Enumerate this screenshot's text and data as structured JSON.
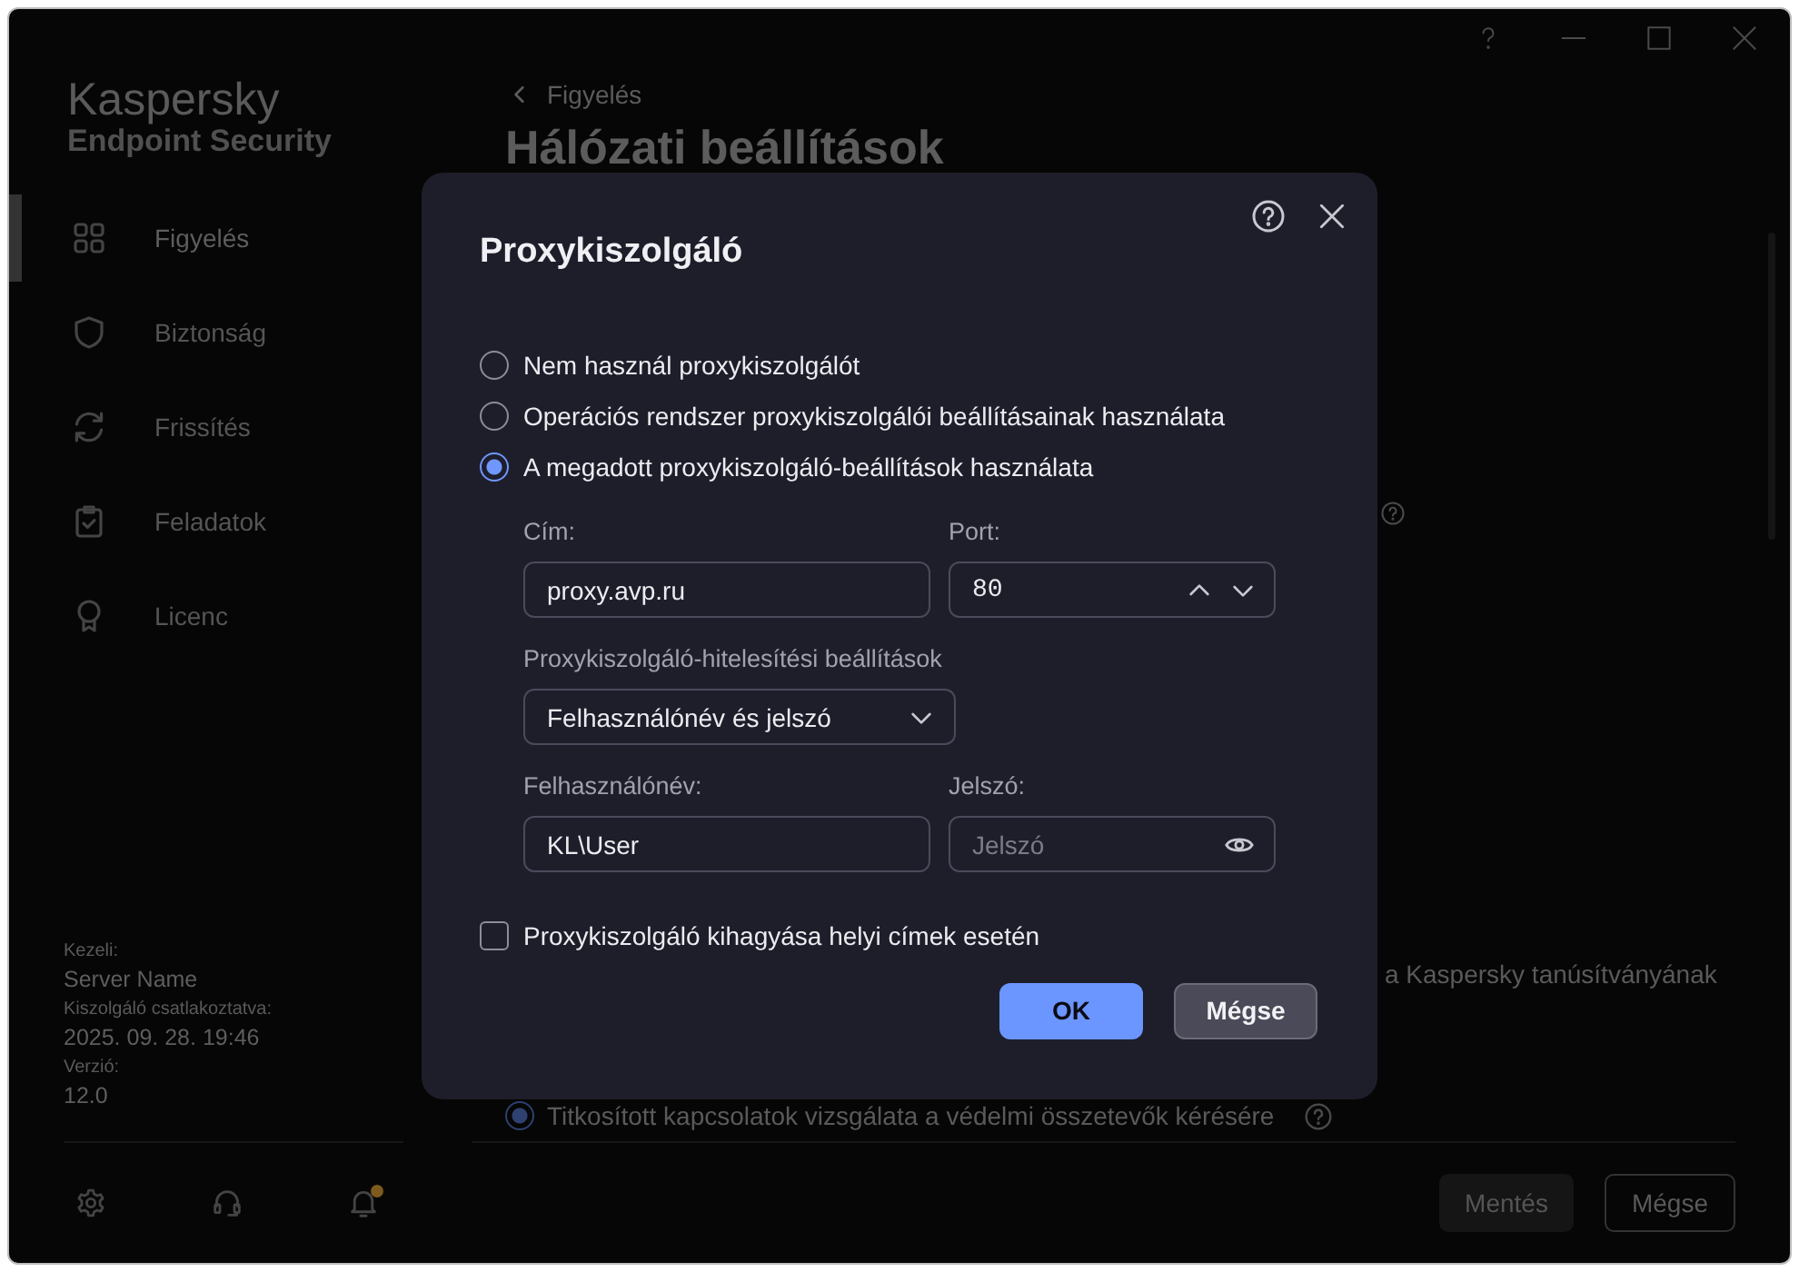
{
  "sidebar": {
    "brand": "Kaspersky",
    "product": "Endpoint Security",
    "items": [
      {
        "label": "Figyelés",
        "selected": true
      },
      {
        "label": "Biztonság",
        "selected": false
      },
      {
        "label": "Frissítés",
        "selected": false
      },
      {
        "label": "Feladatok",
        "selected": false
      },
      {
        "label": "Licenc",
        "selected": false
      }
    ],
    "info": [
      {
        "label": "Kezeli:",
        "value": "Server Name"
      },
      {
        "label": "Kiszolgáló csatlakoztatva:",
        "value": "2025. 09. 28. 19:46"
      },
      {
        "label": "Verzió:",
        "value": "12.0"
      }
    ],
    "notifications": {
      "unread": true
    }
  },
  "main": {
    "back_link": "Figyelés",
    "title": "Hálózati beállítások",
    "text_fragment": "a Kaspersky tanúsítványának",
    "option": {
      "label": "Titkosított kapcsolatok vizsgálata a védelmi összetevők kérésére",
      "selected": true
    },
    "buttons": [
      {
        "label": "Mentés",
        "kind": "primary",
        "disabled": true
      },
      {
        "label": "Mégse",
        "kind": "secondary",
        "disabled": false
      }
    ]
  },
  "dialog": {
    "title": "Proxykiszolgáló",
    "options": [
      {
        "label": "Nem használ proxykiszolgálót",
        "selected": false
      },
      {
        "label": "Operációs rendszer proxykiszolgálói beállításainak használata",
        "selected": false
      },
      {
        "label": "A megadott proxykiszolgáló-beállítások használata",
        "selected": true
      }
    ],
    "address": {
      "label": "Cím:",
      "value": "proxy.avp.ru"
    },
    "port": {
      "label": "Port:",
      "value": "80"
    },
    "auth": {
      "label": "Proxykiszolgáló-hitelesítési beállítások",
      "value": "Felhasználónév és jelszó"
    },
    "username": {
      "label": "Felhasználónév:",
      "value": "KL\\User"
    },
    "password": {
      "label": "Jelszó:",
      "placeholder": "Jelszó"
    },
    "bypass": {
      "label": "Proxykiszolgáló kihagyása helyi címek esetén",
      "checked": false
    },
    "buttons": [
      {
        "label": "OK",
        "kind": "primary"
      },
      {
        "label": "Mégse",
        "kind": "secondary"
      }
    ]
  }
}
